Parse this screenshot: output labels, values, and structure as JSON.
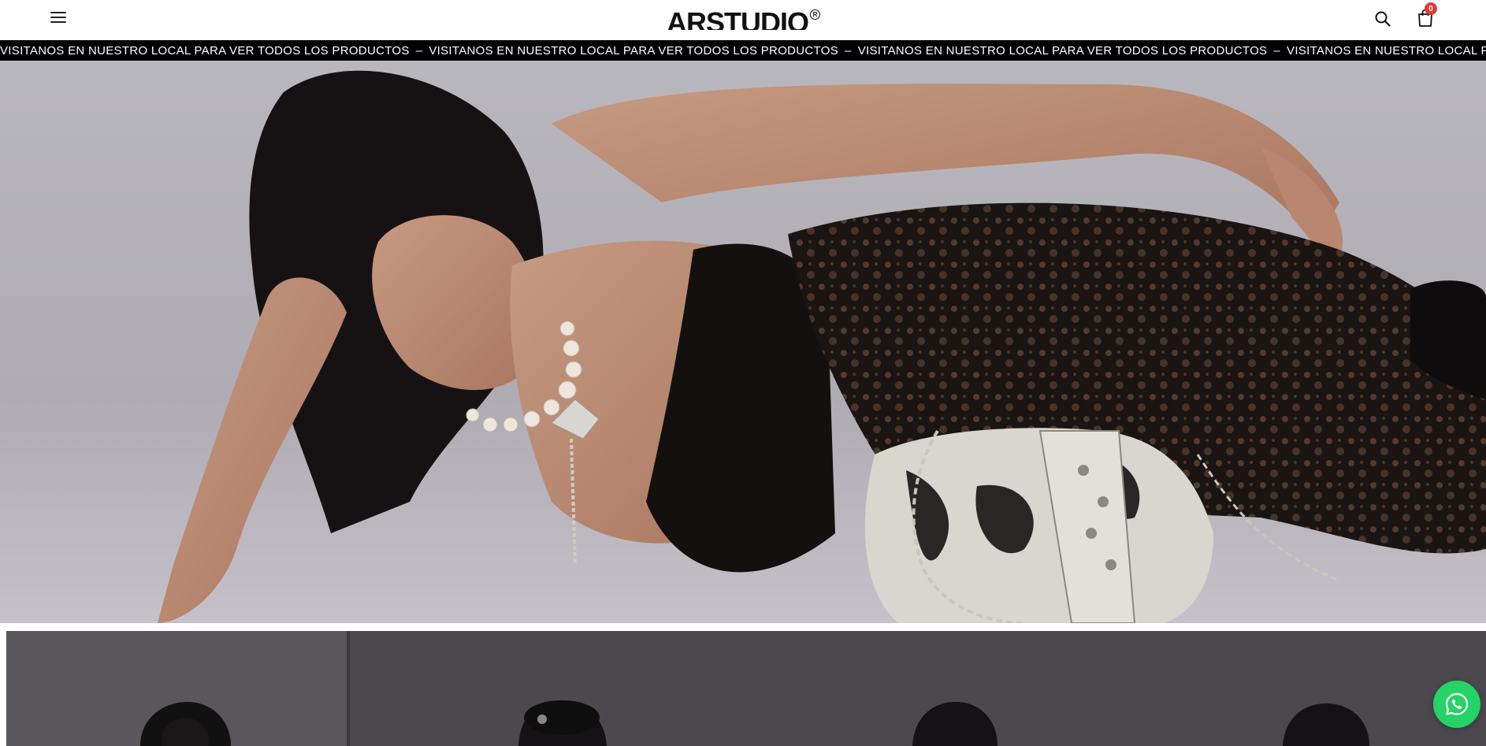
{
  "header": {
    "brand": "ARSTUDIO",
    "cart_count": "0",
    "icons": {
      "menu": "hamburger-menu-icon",
      "search": "search-icon",
      "cart": "shopping-bag-icon"
    }
  },
  "announcement": {
    "text": "VISITANOS EN NUESTRO LOCAL PARA VER TODOS LOS PRODUCTOS",
    "separator": "–"
  },
  "hero": {
    "image": "model-in-black-lace-dress-with-pearl-necklace-and-cow-print-bag"
  },
  "collection": {
    "image": "models-in-black-outfits-collage"
  },
  "whatsapp": {
    "icon": "whatsapp-icon",
    "color": "#25d366"
  },
  "colors": {
    "accent_badge": "#e53935",
    "marquee_bg": "#000000",
    "marquee_text": "#ffffff"
  }
}
